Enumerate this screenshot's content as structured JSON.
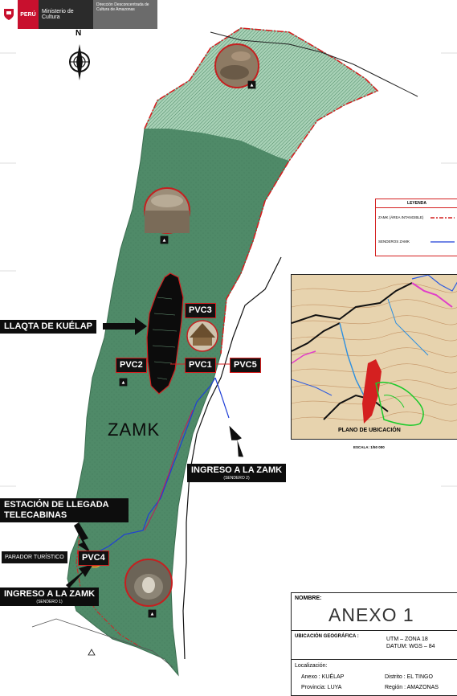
{
  "header": {
    "country": "PERÚ",
    "ministry": "Ministerio de Cultura",
    "directorate": "Dirección Desconcentrada de Cultura de Amazonas"
  },
  "north_label": "N",
  "labels": {
    "llaqta": "LLAQTA DE KUÉLAP",
    "pvc3": "PVC3",
    "pvc2": "PVC2",
    "pvc1": "PVC1",
    "pvc5": "PVC5",
    "pvc4": "PVC4",
    "zamk": "ZAMK",
    "ingreso_zamk_2": "INGRESO A LA ZAMK",
    "sendero_2": "(SENDERO 2)",
    "estacion": "ESTACIÓN DE LLEGADA",
    "telecabinas": "TELECABINAS",
    "parador": "PARADOR TURÍSTICO",
    "ingreso_zamk_1": "INGRESO A LA ZAMK",
    "sendero_1": "(SENDERO 1)"
  },
  "legend": {
    "title": "LEYENDA",
    "items": [
      {
        "label": "ZAMK (ÁREA INTANGIBLE)",
        "color": "#d42020"
      },
      {
        "label": "SENDEROS ZAMK",
        "color": "#1f3fd6"
      }
    ]
  },
  "inset": {
    "title": "PLANO DE UBICACIÓN",
    "scale": "ESCALA: 1/50 000"
  },
  "title_block": {
    "nombre_label": "NOMBRE:",
    "nombre": "ANEXO 1",
    "ubicacion_label": "UBICACIÓN GEOGRÁFICA :",
    "utm": "UTM  –  ZONA 18",
    "datum": "DATUM:  WGS – 84",
    "localizacion": "Localización:",
    "anexo": "Anexo : KUÉLAP",
    "distrito": "Distrito : EL TINGO",
    "provincia": "Provincia: LUYA",
    "region": "Región : AMAZONAS"
  },
  "colors": {
    "zamk_fill": "#4f8a68",
    "hatch_fill": "#9ec7ae",
    "boundary": "#d42020",
    "trail": "#1f3fd6"
  }
}
